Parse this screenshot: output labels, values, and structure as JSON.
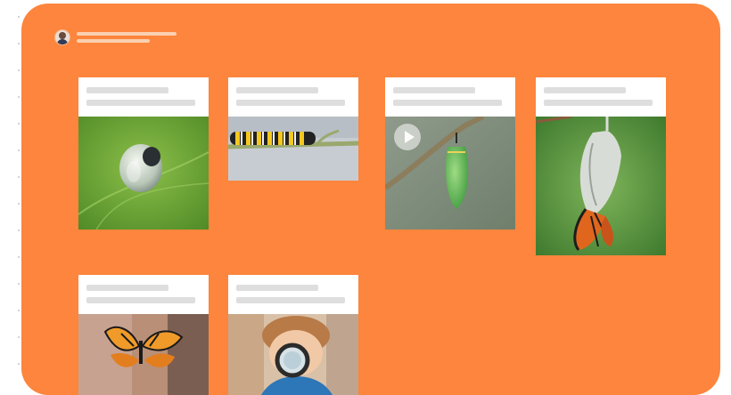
{
  "board": {
    "background": "#fd853d",
    "author": {
      "avatar": "user-avatar"
    }
  },
  "cards": [
    {
      "media": "caterpillar-emerging-from-egg-photo"
    },
    {
      "media": "monarch-caterpillar-on-stem-photo"
    },
    {
      "media": "green-chrysalis-video",
      "has_video": true
    },
    {
      "media": "butterfly-emerging-from-chrysalis-photo"
    },
    {
      "media": "monarch-butterfly-on-hand-photo"
    },
    {
      "media": "child-with-magnifying-glass-photo"
    }
  ]
}
